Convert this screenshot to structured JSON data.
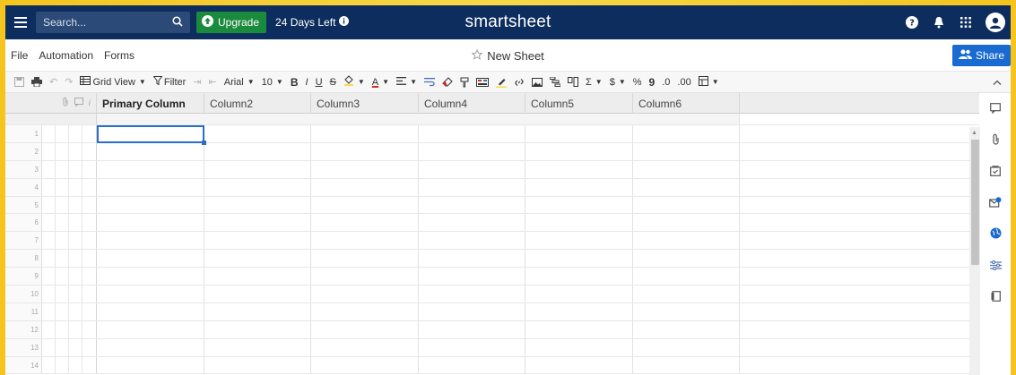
{
  "topbar": {
    "search_placeholder": "Search...",
    "upgrade_label": "Upgrade",
    "trial_text": "24 Days Left",
    "logo": "smartsheet"
  },
  "menubar": {
    "items": [
      "File",
      "Automation",
      "Forms"
    ],
    "sheet_title": "New Sheet",
    "share_label": "Share"
  },
  "toolbar": {
    "view_label": "Grid View",
    "filter_label": "Filter",
    "font_label": "Arial",
    "size_label": "10",
    "bold": "B",
    "italic": "I",
    "underline": "U",
    "strike": "S",
    "font_color": "A",
    "sum": "Σ",
    "currency": "$",
    "percent": "%",
    "thousands": "9",
    "dec_less": ".0",
    "dec_more": ".00"
  },
  "grid": {
    "columns": [
      "Primary Column",
      "Column2",
      "Column3",
      "Column4",
      "Column5",
      "Column6"
    ],
    "rows": [
      "1",
      "2",
      "3",
      "4",
      "5",
      "6",
      "7",
      "8",
      "9",
      "10",
      "11",
      "12",
      "13",
      "14"
    ]
  },
  "colors": {
    "navy": "#0d2d5e",
    "upgrade_green": "#1a8a3c",
    "share_blue": "#1a6bd1",
    "selection": "#2a6ec9"
  }
}
